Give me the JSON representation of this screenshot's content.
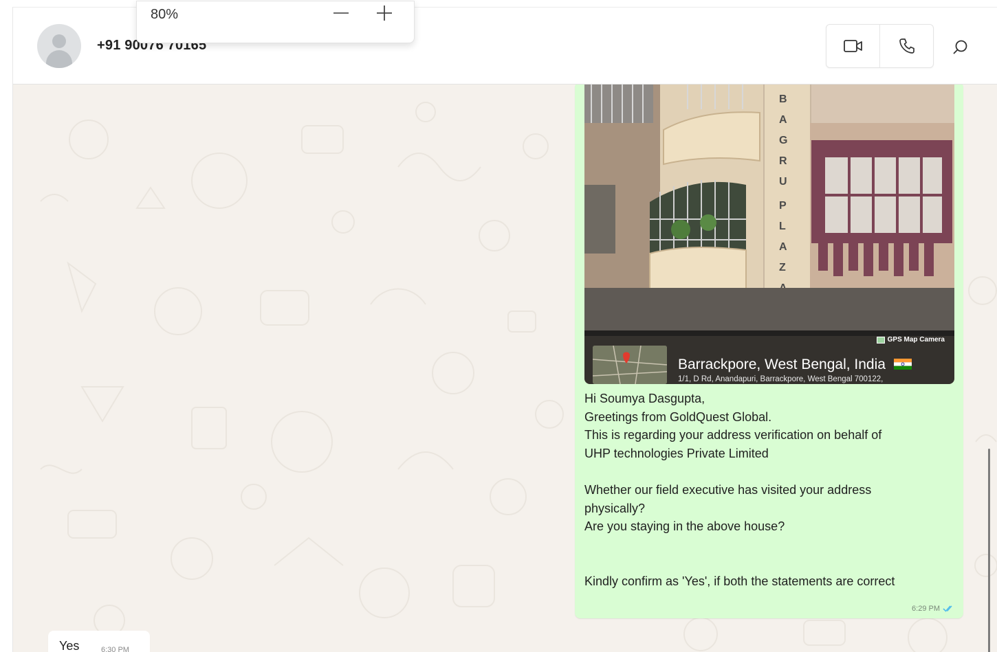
{
  "zoom": {
    "level": "80%"
  },
  "header": {
    "contact_name": "+91 90076 70165"
  },
  "photo": {
    "building_sign": "BAGRU PLAZA-I",
    "overlay_camera": "GPS Map Camera",
    "overlay_city": "Barrackpore, West Bengal, India",
    "overlay_address": "1/1, D Rd, Anandapuri, Barrackpore, West Bengal 700122,"
  },
  "messages": {
    "outgoing": {
      "text": "Hi Soumya Dasgupta,\nGreetings from GoldQuest Global.\nThis is regarding your address verification on behalf of\nUHP technologies Private Limited\n\nWhether our field executive has visited your address\nphysically?\nAre you staying in the above house?\n\n\nKindly confirm as 'Yes', if both the statements are correct",
      "time": "6:29 PM",
      "status": "read"
    },
    "incoming": {
      "text": "Yes",
      "time": "6:30 PM"
    }
  },
  "colors": {
    "outgoing_bubble": "#d9fdd3",
    "chat_background": "#f5f1ec",
    "read_ticks": "#53bdeb"
  }
}
